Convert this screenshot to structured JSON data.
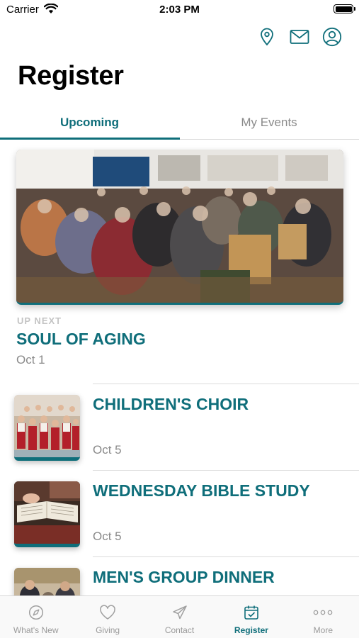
{
  "status": {
    "carrier": "Carrier",
    "time": "2:03 PM"
  },
  "header": {
    "title": "Register",
    "icons": [
      "map-pin-icon",
      "mail-icon",
      "user-circle-icon"
    ]
  },
  "tabs": [
    {
      "label": "Upcoming",
      "active": true
    },
    {
      "label": "My Events",
      "active": false
    }
  ],
  "featured": {
    "eyebrow": "UP NEXT",
    "title": "SOUL OF AGING",
    "date": "Oct 1"
  },
  "events": [
    {
      "title": "CHILDREN'S CHOIR",
      "date": "Oct 5"
    },
    {
      "title": "WEDNESDAY BIBLE STUDY",
      "date": "Oct 5"
    },
    {
      "title": "MEN'S GROUP DINNER",
      "date": ""
    }
  ],
  "tabbar": [
    {
      "label": "What's New",
      "icon": "compass-icon",
      "active": false
    },
    {
      "label": "Giving",
      "icon": "heart-icon",
      "active": false
    },
    {
      "label": "Contact",
      "icon": "paper-plane-icon",
      "active": false
    },
    {
      "label": "Register",
      "icon": "calendar-check-icon",
      "active": true
    },
    {
      "label": "More",
      "icon": "more-dots-icon",
      "active": false
    }
  ],
  "colors": {
    "accent": "#0f6e7a",
    "muted": "#8a8a8a"
  }
}
